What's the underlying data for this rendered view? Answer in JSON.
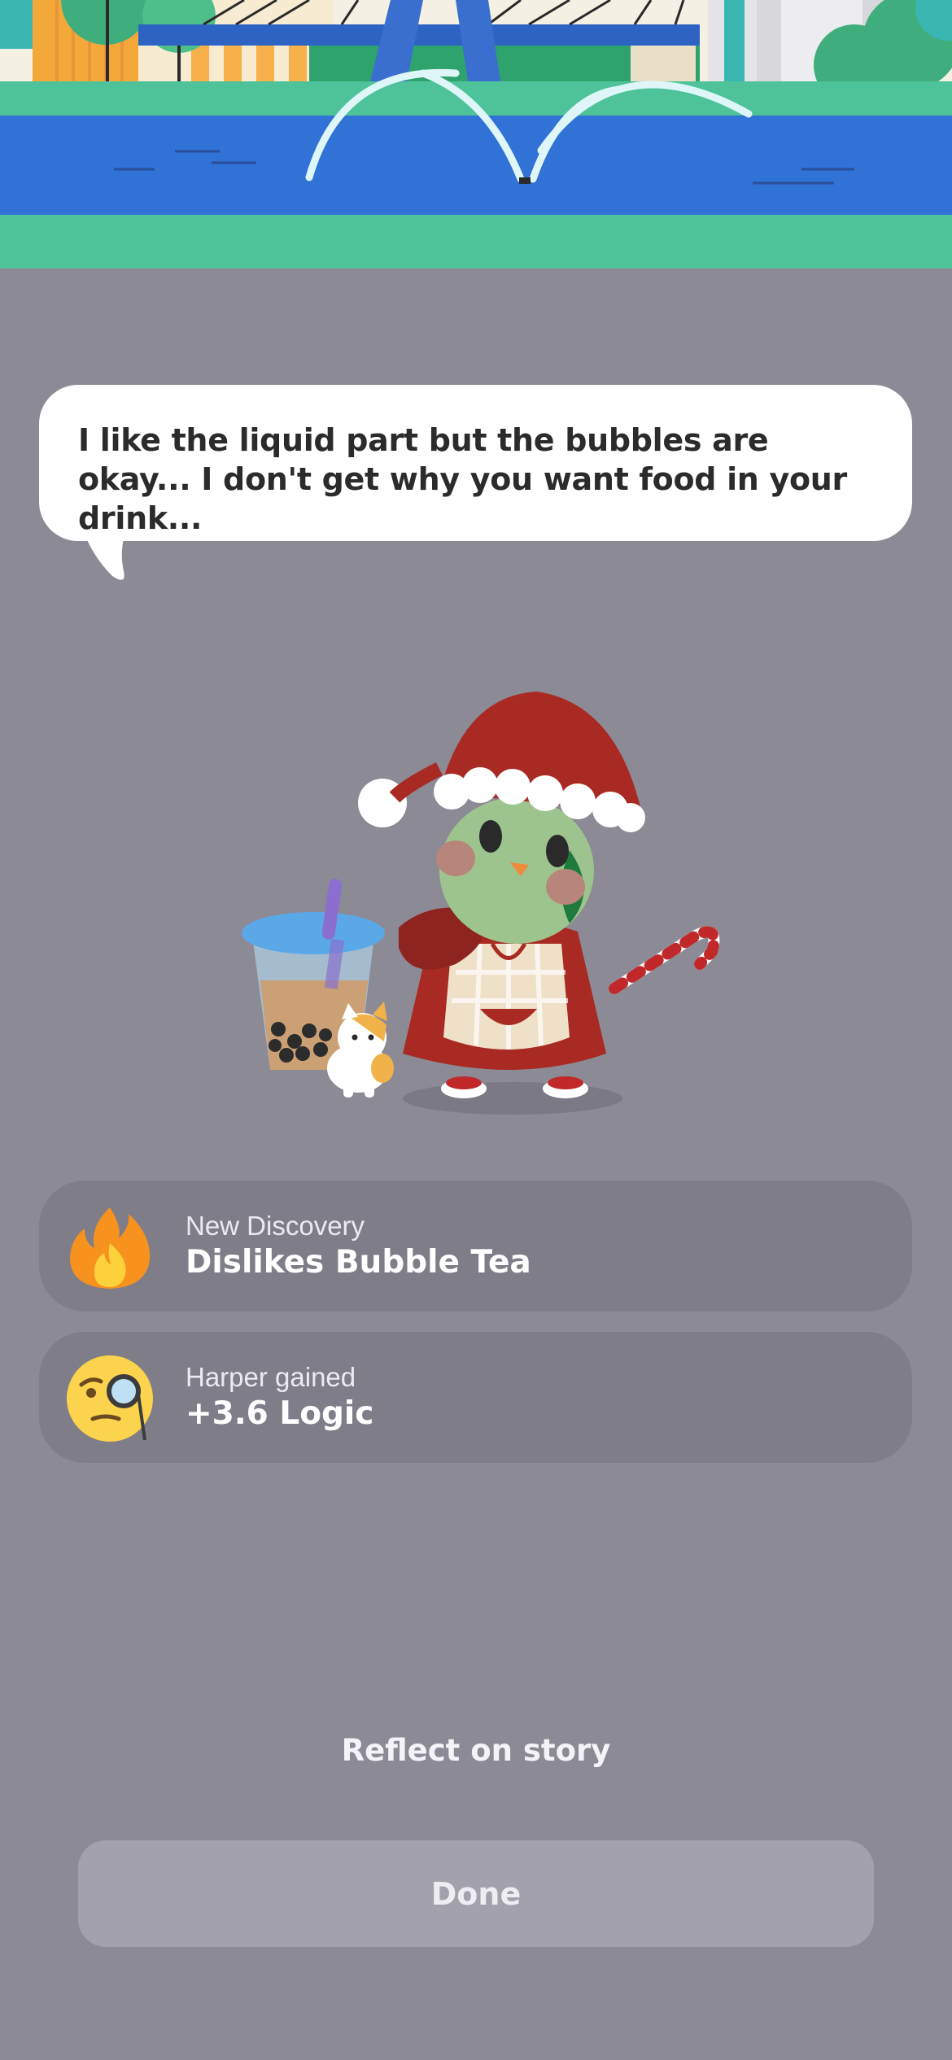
{
  "dialogue": {
    "text": "I like the liquid part but the bubbles are okay... I don't get why you want food in your drink..."
  },
  "discovery": {
    "label": "New Discovery",
    "value": "Dislikes Bubble Tea",
    "icon": "fire-icon"
  },
  "gain": {
    "label": "Harper gained",
    "value": "+3.6 Logic",
    "icon": "monocle-face-icon"
  },
  "actions": {
    "reflect_label": "Reflect on story",
    "done_label": "Done"
  },
  "colors": {
    "background": "#8c8a94",
    "card": "#7f7d87",
    "button": "#a3a1ab",
    "river": "#3172d6",
    "grass": "#4ec39a"
  }
}
